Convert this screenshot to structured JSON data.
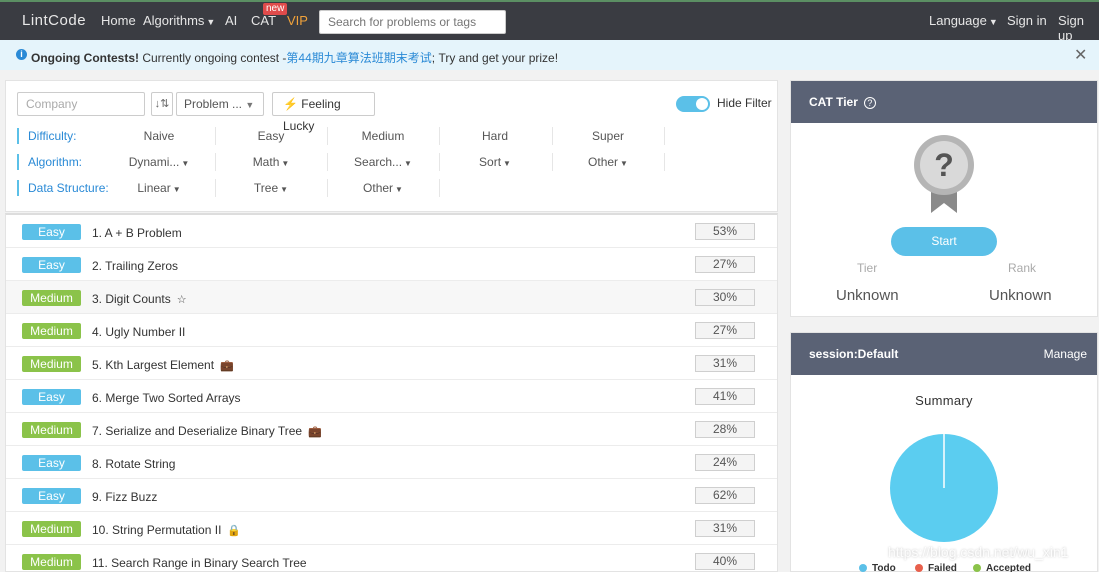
{
  "nav": {
    "logo": "LintCode",
    "home": "Home",
    "algorithms": "Algorithms",
    "ai": "AI",
    "cat": "CAT",
    "cat_badge": "new",
    "vip": "VIP",
    "search_placeholder": "Search for problems or tags",
    "language": "Language",
    "sign_in": "Sign in",
    "sign_up": "Sign up"
  },
  "banner": {
    "title": "Ongoing Contests!",
    "text_before": "Currently ongoing contest -",
    "contest_link": "第44期九章算法班期末考试",
    "text_after": "; Try and get your prize!"
  },
  "filters": {
    "company_placeholder": "Company",
    "problem_select": "Problem ...",
    "feeling_lucky": "Feeling Lucky",
    "hide_filter": "Hide Filter",
    "difficulty_label": "Difficulty:",
    "difficulty_options": [
      "Naive",
      "Easy",
      "Medium",
      "Hard",
      "Super"
    ],
    "algorithm_label": "Algorithm:",
    "algorithm_options": [
      "Dynami...",
      "Math",
      "Search...",
      "Sort",
      "Other"
    ],
    "data_structure_label": "Data Structure:",
    "data_structure_options": [
      "Linear",
      "Tree",
      "Other"
    ]
  },
  "problems": [
    {
      "difficulty": "Easy",
      "title": "1. A + B Problem",
      "rate": "53%",
      "icon": ""
    },
    {
      "difficulty": "Easy",
      "title": "2. Trailing Zeros",
      "rate": "27%",
      "icon": ""
    },
    {
      "difficulty": "Medium",
      "title": "3. Digit Counts",
      "rate": "30%",
      "icon": "star-icon"
    },
    {
      "difficulty": "Medium",
      "title": "4. Ugly Number II",
      "rate": "27%",
      "icon": ""
    },
    {
      "difficulty": "Medium",
      "title": "5. Kth Largest Element",
      "rate": "31%",
      "icon": "briefcase-icon"
    },
    {
      "difficulty": "Easy",
      "title": "6. Merge Two Sorted Arrays",
      "rate": "41%",
      "icon": ""
    },
    {
      "difficulty": "Medium",
      "title": "7. Serialize and Deserialize Binary Tree",
      "rate": "28%",
      "icon": "briefcase-icon"
    },
    {
      "difficulty": "Easy",
      "title": "8. Rotate String",
      "rate": "24%",
      "icon": ""
    },
    {
      "difficulty": "Easy",
      "title": "9. Fizz Buzz",
      "rate": "62%",
      "icon": ""
    },
    {
      "difficulty": "Medium",
      "title": "10. String Permutation II",
      "rate": "31%",
      "icon": "lock-icon"
    },
    {
      "difficulty": "Medium",
      "title": "11. Search Range in Binary Search Tree",
      "rate": "40%",
      "icon": ""
    }
  ],
  "cat_tier": {
    "title": "CAT Tier",
    "start": "Start",
    "tier_label": "Tier",
    "rank_label": "Rank",
    "tier_value": "Unknown",
    "rank_value": "Unknown"
  },
  "session": {
    "title": "session:Default",
    "manage": "Manage",
    "summary": "Summary",
    "legend": [
      "Todo",
      "Failed",
      "Accepted"
    ]
  },
  "colors": {
    "easy": "#5bc0e8",
    "medium": "#8bc34a",
    "failed": "#e8604c",
    "navbar": "#3a3c42",
    "panel_header": "#5a6275"
  },
  "watermark": "https://blog.csdn.net/wu_xin1"
}
